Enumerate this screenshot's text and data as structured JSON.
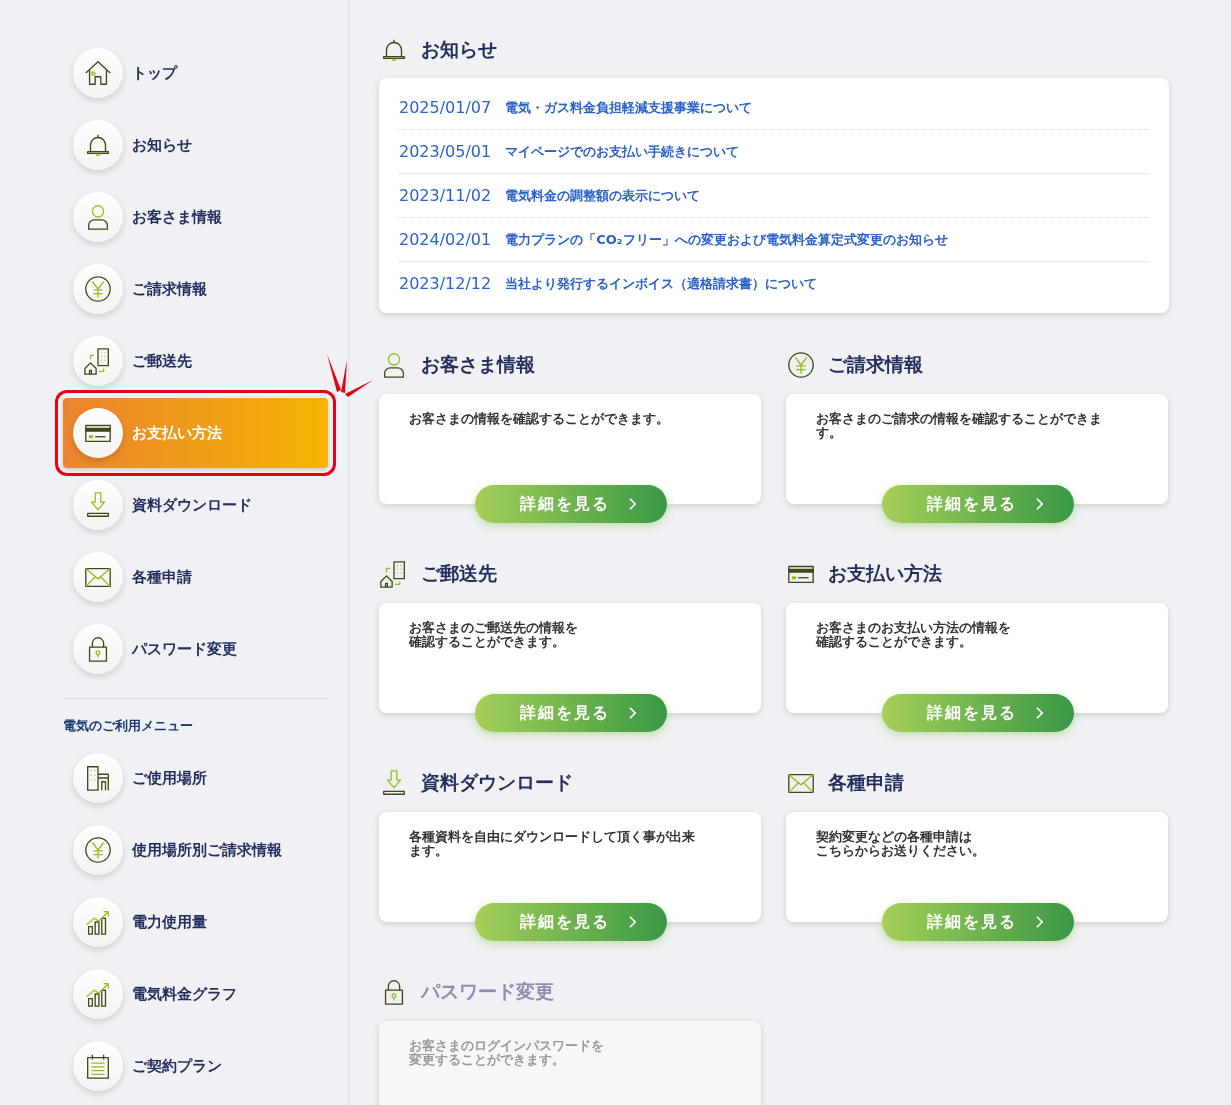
{
  "sidebar": {
    "items": [
      {
        "label": "トップ",
        "kind": "home",
        "selected": false
      },
      {
        "label": "お知らせ",
        "kind": "bell",
        "selected": false
      },
      {
        "label": "お客さま情報",
        "kind": "person",
        "selected": false
      },
      {
        "label": "ご請求情報",
        "kind": "yen",
        "selected": false
      },
      {
        "label": "ご郵送先",
        "kind": "address",
        "selected": false
      },
      {
        "label": "お支払い方法",
        "kind": "card",
        "selected": true
      },
      {
        "label": "資料ダウンロード",
        "kind": "download",
        "selected": false
      },
      {
        "label": "各種申請",
        "kind": "envelope",
        "selected": false
      },
      {
        "label": "パスワード変更",
        "kind": "lock",
        "selected": false
      }
    ],
    "section_title": "電気のご利用メニュー",
    "section_items": [
      {
        "label": "ご使用場所",
        "kind": "buildings",
        "selected": false
      },
      {
        "label": "使用場所別ご請求情報",
        "kind": "yen",
        "selected": false
      },
      {
        "label": "電力使用量",
        "kind": "chart",
        "selected": false
      },
      {
        "label": "電気料金グラフ",
        "kind": "chart",
        "selected": false
      },
      {
        "label": "ご契約プラン",
        "kind": "calendar",
        "selected": false
      }
    ]
  },
  "notices": {
    "title": "お知らせ",
    "kind": "bell",
    "items": [
      {
        "date": "2025/01/07",
        "title": "電気・ガス料金負担軽減支援事業について"
      },
      {
        "date": "2023/05/01",
        "title": "マイページでのお支払い手続きについて"
      },
      {
        "date": "2023/11/02",
        "title": "電気料金の調整額の表示について"
      },
      {
        "date": "2024/02/01",
        "title": "電力プランの「CO₂フリー」への変更および電気料金算定式変更のお知らせ"
      },
      {
        "date": "2023/12/12",
        "title": "当社より発行するインボイス（適格請求書）について"
      }
    ]
  },
  "cards": [
    {
      "title": "お客さま情報",
      "kind": "person",
      "description_lines": [
        "お客さまの情報を確認することができます。"
      ],
      "button": "詳細を見る",
      "disabled": false
    },
    {
      "title": "ご請求情報",
      "kind": "yen",
      "description_lines": [
        "お客さまのご請求の情報を確認することができま",
        "す。"
      ],
      "button": "詳細を見る",
      "disabled": false
    },
    {
      "title": "ご郵送先",
      "kind": "address",
      "description_lines": [
        "お客さまのご郵送先の情報を",
        "確認することができます。"
      ],
      "button": "詳細を見る",
      "disabled": false
    },
    {
      "title": "お支払い方法",
      "kind": "card",
      "description_lines": [
        "お客さまのお支払い方法の情報を",
        "確認することができます。"
      ],
      "button": "詳細を見る",
      "disabled": false
    },
    {
      "title": "資料ダウンロード",
      "kind": "download",
      "description_lines": [
        "各種資料を自由にダウンロードして頂く事が出来",
        "ます。"
      ],
      "button": "詳細を見る",
      "disabled": false
    },
    {
      "title": "各種申請",
      "kind": "envelope",
      "description_lines": [
        "契約変更などの各種申請は",
        "こちらからお送りください。"
      ],
      "button": "詳細を見る",
      "disabled": false
    },
    {
      "title": "パスワード変更",
      "kind": "lock",
      "description_lines": [
        "お客さまのログインパスワードを",
        "変更することができます。"
      ],
      "disabled": true
    }
  ]
}
